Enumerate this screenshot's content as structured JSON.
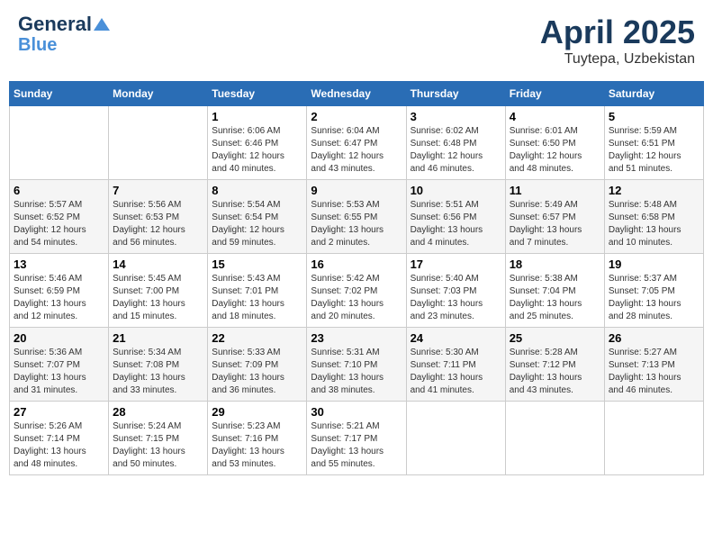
{
  "header": {
    "logo_line1": "General",
    "logo_line2": "Blue",
    "month_title": "April 2025",
    "location": "Tuytepa, Uzbekistan"
  },
  "weekdays": [
    "Sunday",
    "Monday",
    "Tuesday",
    "Wednesday",
    "Thursday",
    "Friday",
    "Saturday"
  ],
  "weeks": [
    [
      {
        "day": "",
        "info": ""
      },
      {
        "day": "",
        "info": ""
      },
      {
        "day": "1",
        "info": "Sunrise: 6:06 AM\nSunset: 6:46 PM\nDaylight: 12 hours\nand 40 minutes."
      },
      {
        "day": "2",
        "info": "Sunrise: 6:04 AM\nSunset: 6:47 PM\nDaylight: 12 hours\nand 43 minutes."
      },
      {
        "day": "3",
        "info": "Sunrise: 6:02 AM\nSunset: 6:48 PM\nDaylight: 12 hours\nand 46 minutes."
      },
      {
        "day": "4",
        "info": "Sunrise: 6:01 AM\nSunset: 6:50 PM\nDaylight: 12 hours\nand 48 minutes."
      },
      {
        "day": "5",
        "info": "Sunrise: 5:59 AM\nSunset: 6:51 PM\nDaylight: 12 hours\nand 51 minutes."
      }
    ],
    [
      {
        "day": "6",
        "info": "Sunrise: 5:57 AM\nSunset: 6:52 PM\nDaylight: 12 hours\nand 54 minutes."
      },
      {
        "day": "7",
        "info": "Sunrise: 5:56 AM\nSunset: 6:53 PM\nDaylight: 12 hours\nand 56 minutes."
      },
      {
        "day": "8",
        "info": "Sunrise: 5:54 AM\nSunset: 6:54 PM\nDaylight: 12 hours\nand 59 minutes."
      },
      {
        "day": "9",
        "info": "Sunrise: 5:53 AM\nSunset: 6:55 PM\nDaylight: 13 hours\nand 2 minutes."
      },
      {
        "day": "10",
        "info": "Sunrise: 5:51 AM\nSunset: 6:56 PM\nDaylight: 13 hours\nand 4 minutes."
      },
      {
        "day": "11",
        "info": "Sunrise: 5:49 AM\nSunset: 6:57 PM\nDaylight: 13 hours\nand 7 minutes."
      },
      {
        "day": "12",
        "info": "Sunrise: 5:48 AM\nSunset: 6:58 PM\nDaylight: 13 hours\nand 10 minutes."
      }
    ],
    [
      {
        "day": "13",
        "info": "Sunrise: 5:46 AM\nSunset: 6:59 PM\nDaylight: 13 hours\nand 12 minutes."
      },
      {
        "day": "14",
        "info": "Sunrise: 5:45 AM\nSunset: 7:00 PM\nDaylight: 13 hours\nand 15 minutes."
      },
      {
        "day": "15",
        "info": "Sunrise: 5:43 AM\nSunset: 7:01 PM\nDaylight: 13 hours\nand 18 minutes."
      },
      {
        "day": "16",
        "info": "Sunrise: 5:42 AM\nSunset: 7:02 PM\nDaylight: 13 hours\nand 20 minutes."
      },
      {
        "day": "17",
        "info": "Sunrise: 5:40 AM\nSunset: 7:03 PM\nDaylight: 13 hours\nand 23 minutes."
      },
      {
        "day": "18",
        "info": "Sunrise: 5:38 AM\nSunset: 7:04 PM\nDaylight: 13 hours\nand 25 minutes."
      },
      {
        "day": "19",
        "info": "Sunrise: 5:37 AM\nSunset: 7:05 PM\nDaylight: 13 hours\nand 28 minutes."
      }
    ],
    [
      {
        "day": "20",
        "info": "Sunrise: 5:36 AM\nSunset: 7:07 PM\nDaylight: 13 hours\nand 31 minutes."
      },
      {
        "day": "21",
        "info": "Sunrise: 5:34 AM\nSunset: 7:08 PM\nDaylight: 13 hours\nand 33 minutes."
      },
      {
        "day": "22",
        "info": "Sunrise: 5:33 AM\nSunset: 7:09 PM\nDaylight: 13 hours\nand 36 minutes."
      },
      {
        "day": "23",
        "info": "Sunrise: 5:31 AM\nSunset: 7:10 PM\nDaylight: 13 hours\nand 38 minutes."
      },
      {
        "day": "24",
        "info": "Sunrise: 5:30 AM\nSunset: 7:11 PM\nDaylight: 13 hours\nand 41 minutes."
      },
      {
        "day": "25",
        "info": "Sunrise: 5:28 AM\nSunset: 7:12 PM\nDaylight: 13 hours\nand 43 minutes."
      },
      {
        "day": "26",
        "info": "Sunrise: 5:27 AM\nSunset: 7:13 PM\nDaylight: 13 hours\nand 46 minutes."
      }
    ],
    [
      {
        "day": "27",
        "info": "Sunrise: 5:26 AM\nSunset: 7:14 PM\nDaylight: 13 hours\nand 48 minutes."
      },
      {
        "day": "28",
        "info": "Sunrise: 5:24 AM\nSunset: 7:15 PM\nDaylight: 13 hours\nand 50 minutes."
      },
      {
        "day": "29",
        "info": "Sunrise: 5:23 AM\nSunset: 7:16 PM\nDaylight: 13 hours\nand 53 minutes."
      },
      {
        "day": "30",
        "info": "Sunrise: 5:21 AM\nSunset: 7:17 PM\nDaylight: 13 hours\nand 55 minutes."
      },
      {
        "day": "",
        "info": ""
      },
      {
        "day": "",
        "info": ""
      },
      {
        "day": "",
        "info": ""
      }
    ]
  ]
}
